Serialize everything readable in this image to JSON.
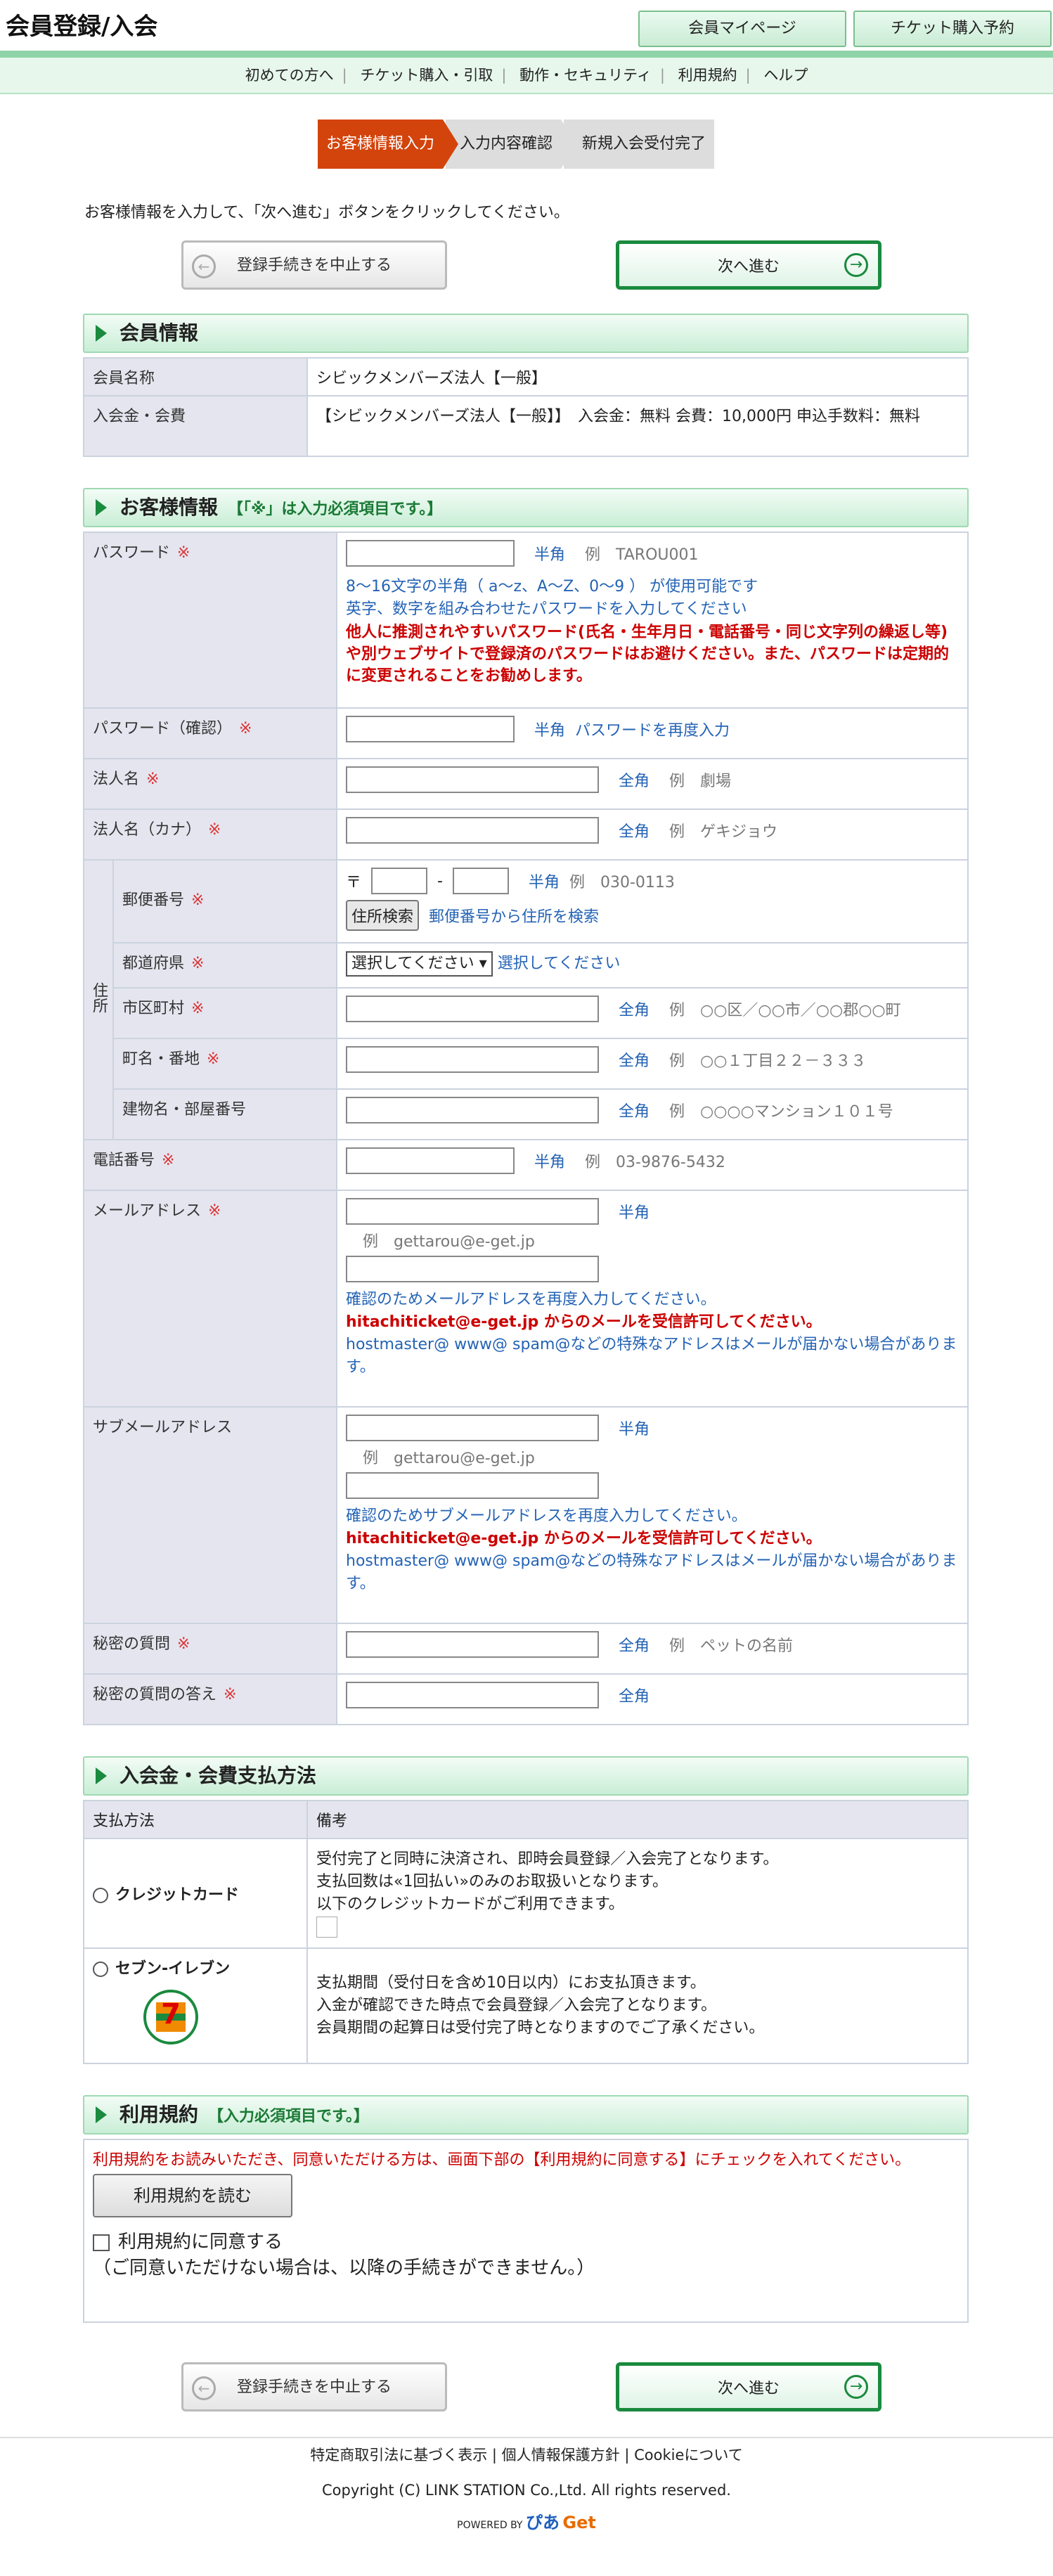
{
  "header": {
    "title": "会員登録/入会",
    "mypage_label": "会員マイページ",
    "ticket_label": "チケット購入予約"
  },
  "nav": {
    "items": [
      "初めての方へ",
      "チケット購入・引取",
      "動作・セキュリティ",
      "利用規約",
      "ヘルプ"
    ]
  },
  "steps": [
    "お客様情報入力",
    "入力内容確認",
    "新規入会受付完了"
  ],
  "intro": "お客様情報を入力して、「次へ進む」ボタンをクリックしてください。",
  "buttons": {
    "cancel": "登録手続きを中止する",
    "next": "次へ進む",
    "postal_search": "住所検索",
    "read_terms": "利用規約を読む"
  },
  "member_info": {
    "title": "会員情報",
    "rows": [
      {
        "label": "会員名称",
        "value": "シビックメンバーズ法人【一般】"
      },
      {
        "label": "入会金・会費",
        "value": "【シビックメンバーズ法人【一般】】　入会金：無料 会費：10,000円 申込手数料：無料"
      }
    ]
  },
  "customer": {
    "title": "お客様情報",
    "note": "【「※」は入力必須項目です。】",
    "req_mark": "※",
    "password": {
      "label": "パスワード",
      "type": "半角",
      "ex": "例　TAROU001",
      "hint1": "8～16文字の半角（ a～z、A～Z、0～9 ） が使用可能です",
      "hint2": "英字、数字を組み合わせたパスワードを入力してください",
      "warn": "他人に推測されやすいパスワード(氏名・生年月日・電話番号・同じ文字列の繰返し等)や別ウェブサイトで登録済のパスワードはお避けください。また、パスワードは定期的に変更されることをお勧めします。"
    },
    "password_confirm": {
      "label": "パスワード（確認）",
      "type": "半角",
      "hint": "パスワードを再度入力"
    },
    "corp_name": {
      "label": "法人名",
      "type": "全角",
      "ex": "例　劇場"
    },
    "corp_kana": {
      "label": "法人名（カナ）",
      "type": "全角",
      "ex": "例　ゲキジョウ"
    },
    "address_label": "住所",
    "postal": {
      "label": "郵便番号",
      "prefix": "〒",
      "dash": "-",
      "type": "半角",
      "ex": "例　030-0113",
      "link": "郵便番号から住所を検索"
    },
    "pref": {
      "label": "都道府県",
      "selected": "選択してください",
      "hint": "選択してください"
    },
    "city": {
      "label": "市区町村",
      "type": "全角",
      "ex": "例　○○区／○○市／○○郡○○町"
    },
    "street": {
      "label": "町名・番地",
      "type": "全角",
      "ex": "例　○○１丁目２２－３３３"
    },
    "building": {
      "label": "建物名・部屋番号",
      "type": "全角",
      "ex": "例　○○○○マンション１０１号"
    },
    "phone": {
      "label": "電話番号",
      "type": "半角",
      "ex": "例　03-9876-5432"
    },
    "email": {
      "label": "メールアドレス",
      "type": "半角",
      "ex": "例　gettarou@e-get.jp",
      "confirm": "確認のためメールアドレスを再度入力してください。",
      "warn": "hitachiticket@e-get.jp からのメールを受信許可してください。",
      "note": "hostmaster@ www@ spam@などの特殊なアドレスはメールが届かない場合があります。"
    },
    "sub_email": {
      "label": "サブメールアドレス",
      "type": "半角",
      "ex": "例　gettarou@e-get.jp",
      "confirm": "確認のためサブメールアドレスを再度入力してください。",
      "warn": "hitachiticket@e-get.jp からのメールを受信許可してください。",
      "note": "hostmaster@ www@ spam@などの特殊なアドレスはメールが届かない場合があります。"
    },
    "secret_q": {
      "label": "秘密の質問",
      "type": "全角",
      "ex": "例　ペットの名前"
    },
    "secret_a": {
      "label": "秘密の質問の答え",
      "type": "全角"
    }
  },
  "payment": {
    "title": "入会金・会費支払方法",
    "col1": "支払方法",
    "col2": "備考",
    "credit": {
      "label": "クレジットカード",
      "l1": "受付完了と同時に決済され、即時会員登録／入会完了となります。",
      "l2": "支払回数は«1回払い»のみのお取扱いとなります。",
      "l3": "以下のクレジットカードがご利用できます。"
    },
    "seven": {
      "label": "セブン-イレブン",
      "logo": "7",
      "l1": "支払期間（受付日を含め10日以内）にお支払頂きます。",
      "l2": "入金が確認できた時点で会員登録／入会完了となります。",
      "l3": "会員期間の起算日は受付完了時となりますのでご了承ください。"
    }
  },
  "terms": {
    "title": "利用規約",
    "note": "【入力必須項目です。】",
    "desc": "利用規約をお読みいただき、同意いただける方は、画面下部の【利用規約に同意する】にチェックを入れてください。",
    "agree": "利用規約に同意する",
    "warn": "（ご同意いただけない場合は、以降の手続きができません。）"
  },
  "footer": {
    "links": [
      "特定商取引法に基づく表示",
      "個人情報保護方針",
      "Cookieについて"
    ],
    "sep": "|",
    "copyright": "Copyright (C) LINK STATION Co.,Ltd. All rights reserved.",
    "powered": "POWERED BY",
    "logo_a": "ぴあ",
    "logo_b": "Get"
  }
}
